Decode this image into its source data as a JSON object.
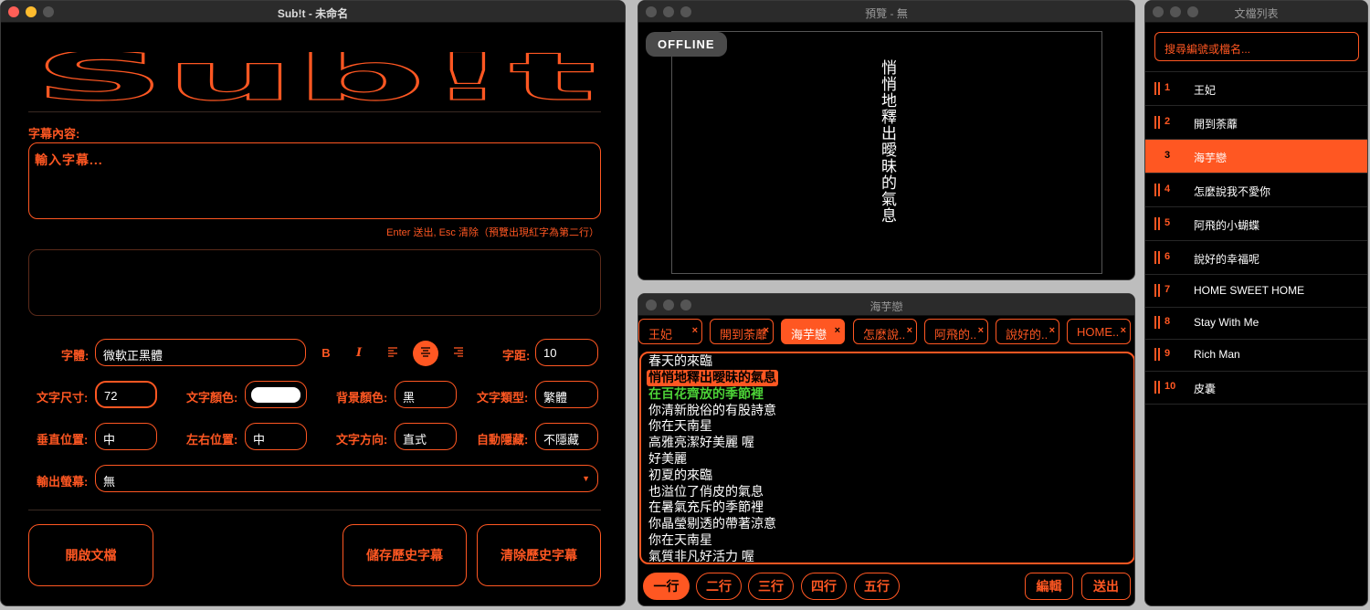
{
  "main": {
    "title": "Sub!t - 未命名",
    "logo_text": "Sub!t",
    "content_label": "字幕內容:",
    "content_placeholder": "輸入字幕...",
    "hint": "Enter 送出, Esc 清除（預覽出現紅字為第二行）",
    "font_label": "字體:",
    "font_value": "微軟正黑體",
    "bold": "B",
    "italic": "I",
    "spacing_label": "字距:",
    "spacing_value": "10",
    "size_label": "文字尺寸:",
    "size_value": "72",
    "color_label": "文字顏色:",
    "text_color": "#ffffff",
    "bg_label": "背景顏色:",
    "bg_value": "黑",
    "type_label": "文字類型:",
    "type_value": "繁體",
    "vpos_label": "垂直位置:",
    "vpos_value": "中",
    "hpos_label": "左右位置:",
    "hpos_value": "中",
    "dir_label": "文字方向:",
    "dir_value": "直式",
    "autohide_label": "自動隱藏:",
    "autohide_value": "不隱藏",
    "output_label": "輸出螢幕:",
    "output_value": "無",
    "open_button": "開啟文檔",
    "save_button": "儲存歷史字幕",
    "clear_button": "清除歷史字幕",
    "accent": "#ff5722"
  },
  "preview": {
    "title": "預覽 - 無",
    "status": "OFFLINE",
    "text": "悄悄地釋出曖昧的氣息"
  },
  "song": {
    "title": "海芋戀",
    "tabs": [
      "王妃",
      "開到荼蘼",
      "海芋戀",
      "怎麼說..",
      "阿飛的..",
      "說好的..",
      "HOME.."
    ],
    "close_glyph": "×",
    "lyrics": [
      "春天的來臨",
      "悄悄地釋出曖昧的氣息",
      "在百花齊放的季節裡",
      "你清新脫俗的有股詩意",
      "你在天南星",
      "高雅亮潔好美麗 喔",
      "好美麗",
      "初夏的來臨",
      "也溢位了俏皮的氣息",
      "在暑氣充斥的季節裡",
      "你晶瑩剔透的帶著涼意",
      "你在天南星",
      "氣質非凡好活力 喔"
    ],
    "line_buttons": [
      "一行",
      "二行",
      "三行",
      "四行",
      "五行"
    ],
    "edit_button": "編輯",
    "send_button": "送出"
  },
  "files": {
    "title": "文檔列表",
    "search_placeholder": "搜尋編號或檔名...",
    "items": [
      {
        "num": "1",
        "name": "王妃"
      },
      {
        "num": "2",
        "name": "開到荼蘼"
      },
      {
        "num": "3",
        "name": "海芋戀"
      },
      {
        "num": "4",
        "name": "怎麼說我不愛你"
      },
      {
        "num": "5",
        "name": "阿飛的小蝴蝶"
      },
      {
        "num": "6",
        "name": "說好的幸福呢"
      },
      {
        "num": "7",
        "name": "HOME SWEET HOME"
      },
      {
        "num": "8",
        "name": "Stay With Me"
      },
      {
        "num": "9",
        "name": "Rich Man"
      },
      {
        "num": "10",
        "name": "皮囊"
      }
    ]
  }
}
